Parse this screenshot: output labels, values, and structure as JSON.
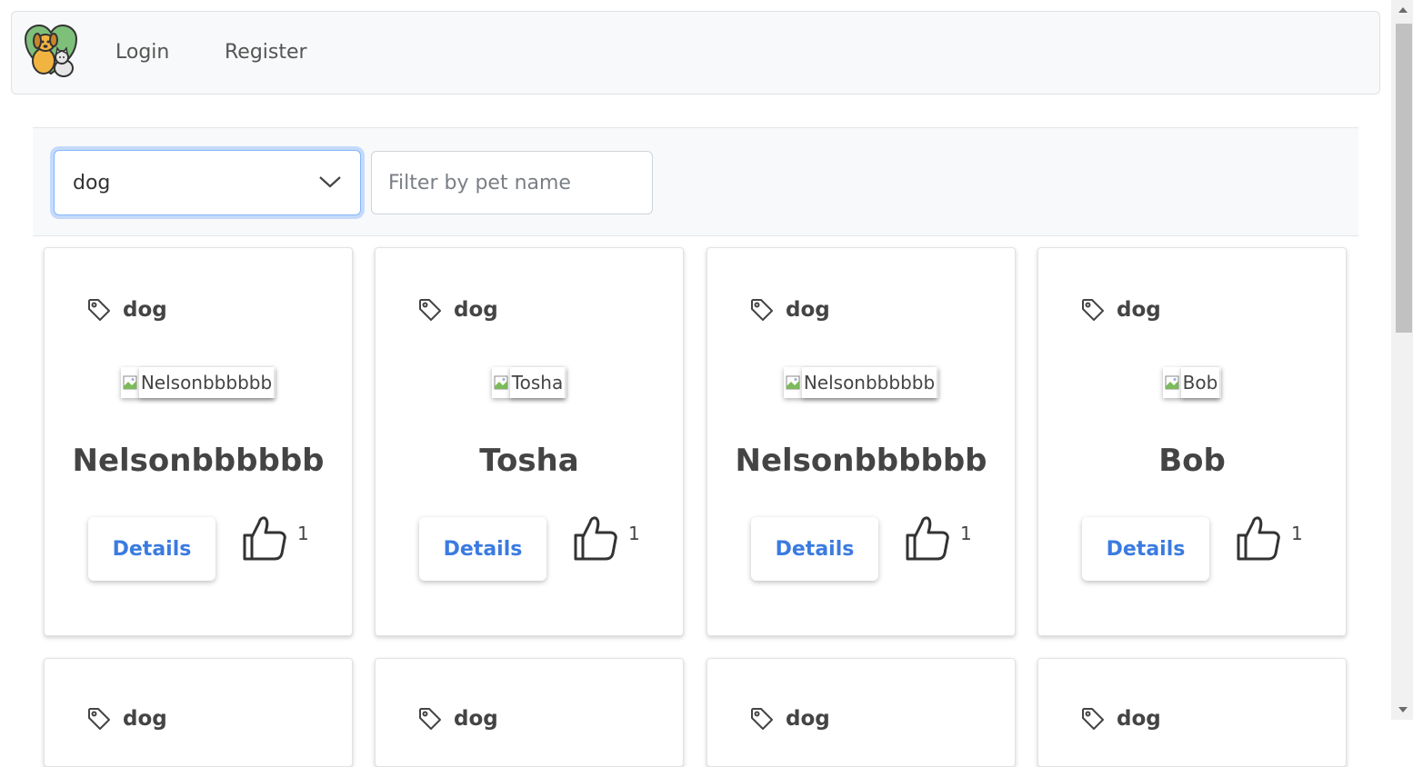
{
  "nav": {
    "logo_icon": "dog-and-cat-heart-logo",
    "login_label": "Login",
    "register_label": "Register"
  },
  "filters": {
    "type_selected": "dog",
    "name_placeholder": "Filter by pet name"
  },
  "cards": [
    {
      "type": "dog",
      "image_alt": "Nelsonbbbbbb",
      "name": "Nelsonbbbbbb",
      "details_label": "Details",
      "likes": "1"
    },
    {
      "type": "dog",
      "image_alt": "Tosha",
      "name": "Tosha",
      "details_label": "Details",
      "likes": "1"
    },
    {
      "type": "dog",
      "image_alt": "Nelsonbbbbbb",
      "name": "Nelsonbbbbbb",
      "details_label": "Details",
      "likes": "1"
    },
    {
      "type": "dog",
      "image_alt": "Bob",
      "name": "Bob",
      "details_label": "Details",
      "likes": "1"
    },
    {
      "type": "dog"
    },
    {
      "type": "dog"
    },
    {
      "type": "dog"
    },
    {
      "type": "dog"
    }
  ],
  "colors": {
    "accent": "#3b7be0",
    "focus_border": "#86b7fe",
    "navbar_bg": "#f8f9fa"
  },
  "icons": {
    "tag": "tag-icon",
    "like": "thumbs-up-icon",
    "dropdown": "chevron-down-icon",
    "broken_image": "broken-image-icon"
  }
}
